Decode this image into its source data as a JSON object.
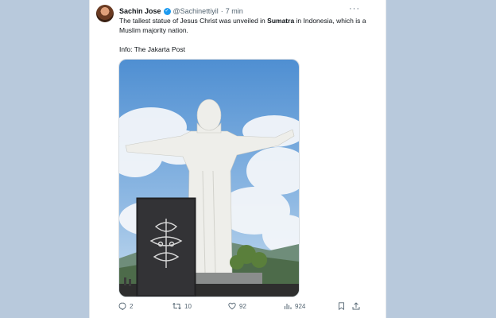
{
  "tweet": {
    "author_name": "Sachin Jose",
    "handle": "@Sachinettiyil",
    "separator": "·",
    "time": "7 min",
    "text_part1": "The tallest statue of Jesus Christ was unveiled in ",
    "text_bold": "Sumatra",
    "text_part2": " in Indonesia, which is a Muslim majority nation.",
    "info_line": "Info: The Jakarta Post",
    "media_icon": "statue-photo",
    "counts": {
      "replies": "2",
      "reposts": "10",
      "likes": "92",
      "views": "924"
    }
  },
  "colors": {
    "background": "#b8c9dc",
    "card": "#ffffff",
    "text": "#0f1419",
    "muted": "#536471",
    "verified": "#1d9bf0"
  },
  "icons": [
    "more-icon",
    "verified-icon",
    "reply-icon",
    "repost-icon",
    "like-icon",
    "views-icon",
    "bookmark-icon",
    "share-icon"
  ]
}
